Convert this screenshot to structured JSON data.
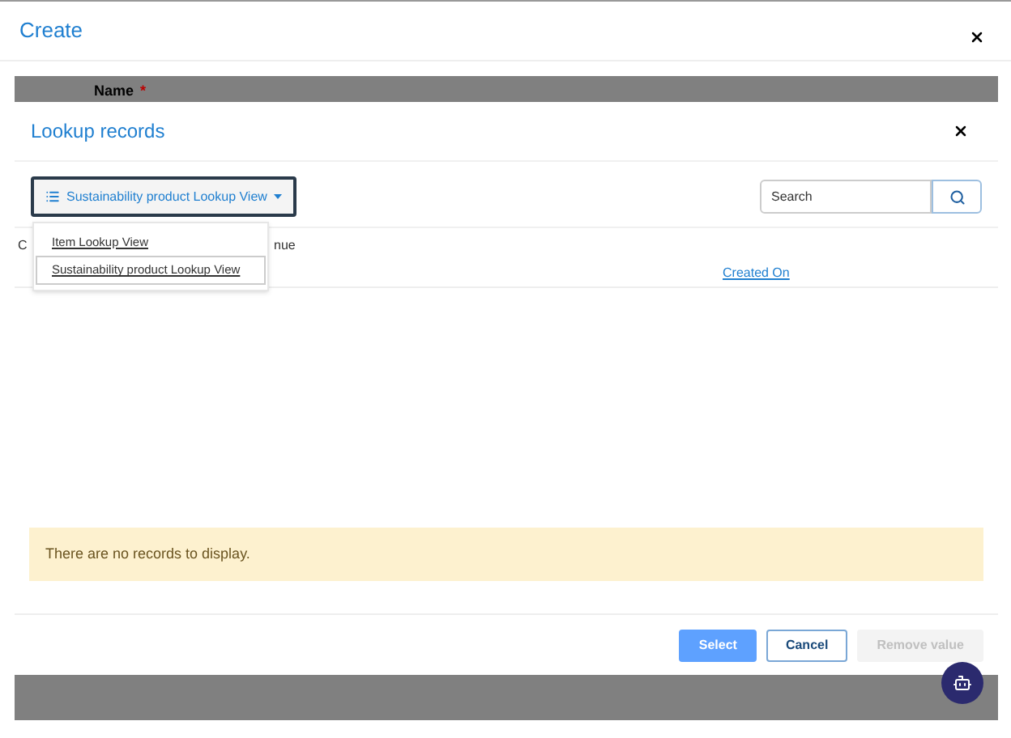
{
  "window": {
    "title": "Create"
  },
  "form": {
    "field_label": "Name",
    "required_mark": "*"
  },
  "lookup": {
    "title": "Lookup records",
    "view_selector": {
      "label": "Sustainability product Lookup View",
      "expanded": true
    },
    "view_options": [
      {
        "label": "Item Lookup View",
        "selected": false
      },
      {
        "label": "Sustainability product Lookup View",
        "selected": true
      }
    ],
    "search": {
      "placeholder": "Search"
    },
    "table": {
      "column_1": "C",
      "column_2": "nue",
      "column_3": "Created On"
    },
    "empty_message": "There are no records to display.",
    "buttons": [
      {
        "label": "Select",
        "kind": "primary",
        "disabled": false
      },
      {
        "label": "Cancel",
        "kind": "secondary",
        "disabled": false
      },
      {
        "label": "Remove value",
        "kind": "secondary",
        "disabled": true
      }
    ]
  }
}
